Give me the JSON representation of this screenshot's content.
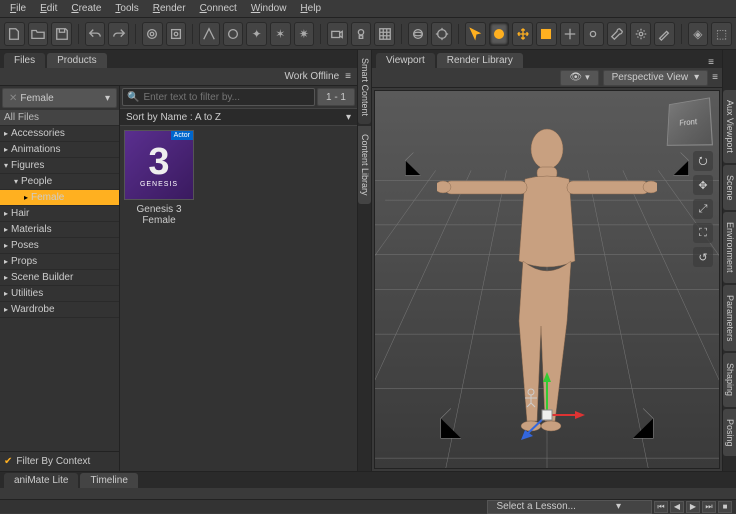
{
  "menu": [
    "File",
    "Edit",
    "Create",
    "Tools",
    "Render",
    "Connect",
    "Window",
    "Help"
  ],
  "left": {
    "tabs": [
      "Files",
      "Products"
    ],
    "workOffline": "Work Offline",
    "categoryHead": "Female",
    "allFiles": "All Files",
    "cats": [
      "Accessories",
      "Animations",
      "Figures",
      "People",
      "Female",
      "Hair",
      "Materials",
      "Poses",
      "Props",
      "Scene Builder",
      "Utilities",
      "Wardrobe"
    ],
    "filter": "Filter By Context",
    "searchPlaceholder": "Enter text to filter by...",
    "pageInfo": "1 - 1",
    "sort": "Sort by Name : A to Z",
    "thumbBadge": "Actor",
    "thumbBrand": "GENESIS",
    "thumbLabel": "Genesis 3 Female"
  },
  "sideL": [
    "Smart Content",
    "Content Library"
  ],
  "viewport": {
    "tabs": [
      "Viewport",
      "Render Library"
    ],
    "camBtn": "Perspective View",
    "cubeLabel": "Front"
  },
  "sideR": [
    "Aux Viewport",
    "Scene",
    "Environment",
    "Parameters",
    "Shaping",
    "Posing"
  ],
  "bottom": {
    "tabs": [
      "aniMate Lite",
      "Timeline"
    ],
    "lesson": "Select a Lesson..."
  },
  "chart_data": null
}
